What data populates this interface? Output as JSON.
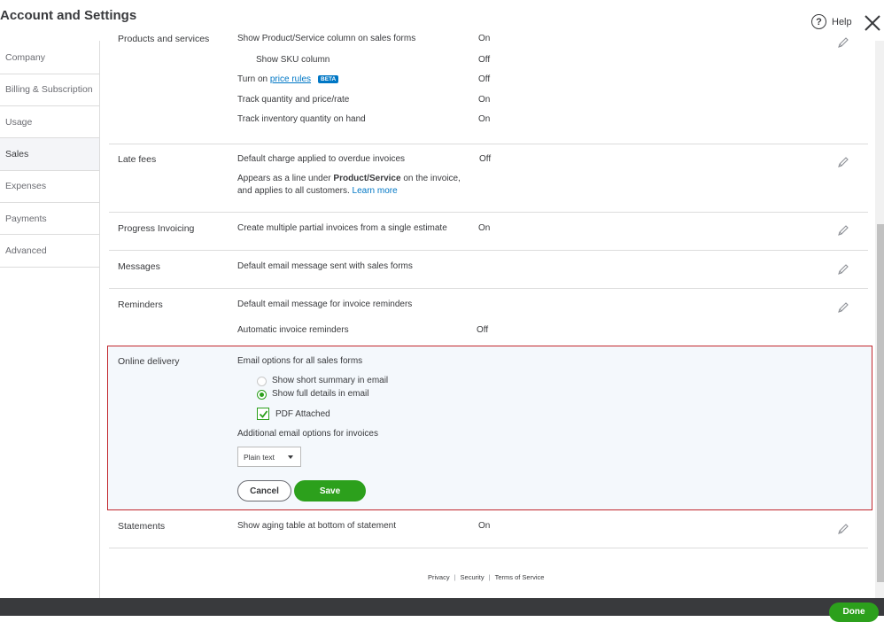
{
  "window": {
    "title": "Account and Settings",
    "help_label": "Help",
    "done_label": "Done"
  },
  "sidebar": {
    "items": [
      {
        "label": "Company"
      },
      {
        "label": "Billing & Subscription"
      },
      {
        "label": "Usage"
      },
      {
        "label": "Sales",
        "active": true
      },
      {
        "label": "Expenses"
      },
      {
        "label": "Payments"
      },
      {
        "label": "Advanced"
      }
    ]
  },
  "products": {
    "label": "Products and services",
    "cut_desc": "Show Product/Service column on sales forms",
    "cut_val": "On",
    "sku_label": "Show SKU column",
    "sku_val": "Off",
    "price_rules_prefix": "Turn on",
    "price_rules_link": "price rules",
    "price_rules_badge": "BETA",
    "price_rules_val": "Off",
    "track_qty_label": "Track quantity and price/rate",
    "track_qty_val": "On",
    "track_inv_label": "Track inventory quantity on hand",
    "track_inv_val": "On"
  },
  "late_fees": {
    "label": "Late fees",
    "desc": "Default charge applied to overdue invoices",
    "val": "Off",
    "note_pre": "Appears as a line under",
    "note_bold": "Product/Service",
    "note_post": "on the invoice,",
    "note_line2": "and applies to all customers.",
    "learn_more": "Learn more"
  },
  "progress_invoicing": {
    "label": "Progress Invoicing",
    "desc": "Create multiple partial invoices from a single estimate",
    "val": "On"
  },
  "messages": {
    "label": "Messages",
    "desc": "Default email message sent with sales forms"
  },
  "reminders": {
    "label": "Reminders",
    "desc": "Default email message for invoice reminders",
    "auto_label": "Automatic invoice reminders",
    "auto_val": "Off"
  },
  "online_delivery": {
    "label": "Online delivery",
    "email_options_title": "Email options for all sales forms",
    "radio_summary": "Show short summary in email",
    "radio_full": "Show full details in email",
    "pdf_label": "PDF Attached",
    "pdf_checked": true,
    "additional_title": "Additional email options for invoices",
    "format_value": "Plain text",
    "cancel_label": "Cancel",
    "save_label": "Save"
  },
  "statements": {
    "label": "Statements",
    "desc": "Show aging table at bottom of statement",
    "val": "On"
  },
  "footer": {
    "privacy": "Privacy",
    "security": "Security",
    "terms": "Terms of Service"
  },
  "colors": {
    "accent_green": "#2ca01c",
    "link_blue": "#0077c5",
    "highlight_border": "#c2272d"
  }
}
